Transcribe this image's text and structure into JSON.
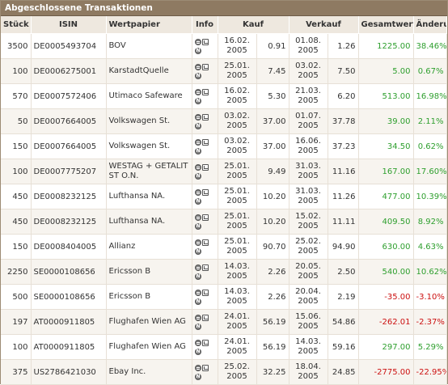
{
  "panel": {
    "title": "Abgeschlossene Transaktionen"
  },
  "columns": {
    "stueck": "Stück",
    "isin": "ISIN",
    "wertpapier": "Wertpapier",
    "info": "Info",
    "kauf": "Kauf",
    "verkauf": "Verkauf",
    "gesamtwert": "Gesamtwert",
    "aenderung": "Änderung"
  },
  "colors": {
    "positive": "#2e9f2e",
    "negative": "#cc1111",
    "header_bar": "#8e7a62"
  },
  "info_icons": [
    "document-icon",
    "chart-icon",
    "news-icon"
  ],
  "rows": [
    {
      "stueck": "3500",
      "isin": "DE0005493704",
      "name": "BOV",
      "kauf_date_1": "16.02.",
      "kauf_date_2": "2005",
      "kauf_price": "0.91",
      "verkauf_date_1": "01.08.",
      "verkauf_date_2": "2005",
      "verkauf_price": "1.26",
      "gesamtwert": "1225.00",
      "aenderung": "38.46%",
      "sign": "pos"
    },
    {
      "stueck": "100",
      "isin": "DE0006275001",
      "name": "KarstadtQuelle",
      "kauf_date_1": "25.01.",
      "kauf_date_2": "2005",
      "kauf_price": "7.45",
      "verkauf_date_1": "03.02.",
      "verkauf_date_2": "2005",
      "verkauf_price": "7.50",
      "gesamtwert": "5.00",
      "aenderung": "0.67%",
      "sign": "pos"
    },
    {
      "stueck": "570",
      "isin": "DE0007572406",
      "name": "Utimaco Safeware",
      "kauf_date_1": "16.02.",
      "kauf_date_2": "2005",
      "kauf_price": "5.30",
      "verkauf_date_1": "21.03.",
      "verkauf_date_2": "2005",
      "verkauf_price": "6.20",
      "gesamtwert": "513.00",
      "aenderung": "16.98%",
      "sign": "pos"
    },
    {
      "stueck": "50",
      "isin": "DE0007664005",
      "name": "Volkswagen St.",
      "kauf_date_1": "03.02.",
      "kauf_date_2": "2005",
      "kauf_price": "37.00",
      "verkauf_date_1": "01.07.",
      "verkauf_date_2": "2005",
      "verkauf_price": "37.78",
      "gesamtwert": "39.00",
      "aenderung": "2.11%",
      "sign": "pos"
    },
    {
      "stueck": "150",
      "isin": "DE0007664005",
      "name": "Volkswagen St.",
      "kauf_date_1": "03.02.",
      "kauf_date_2": "2005",
      "kauf_price": "37.00",
      "verkauf_date_1": "16.06.",
      "verkauf_date_2": "2005",
      "verkauf_price": "37.23",
      "gesamtwert": "34.50",
      "aenderung": "0.62%",
      "sign": "pos"
    },
    {
      "stueck": "100",
      "isin": "DE0007775207",
      "name": "WESTAG + GETALIT ST O.N.",
      "kauf_date_1": "25.01.",
      "kauf_date_2": "2005",
      "kauf_price": "9.49",
      "verkauf_date_1": "31.03.",
      "verkauf_date_2": "2005",
      "verkauf_price": "11.16",
      "gesamtwert": "167.00",
      "aenderung": "17.60%",
      "sign": "pos"
    },
    {
      "stueck": "450",
      "isin": "DE0008232125",
      "name": "Lufthansa NA.",
      "kauf_date_1": "25.01.",
      "kauf_date_2": "2005",
      "kauf_price": "10.20",
      "verkauf_date_1": "31.03.",
      "verkauf_date_2": "2005",
      "verkauf_price": "11.26",
      "gesamtwert": "477.00",
      "aenderung": "10.39%",
      "sign": "pos"
    },
    {
      "stueck": "450",
      "isin": "DE0008232125",
      "name": "Lufthansa NA.",
      "kauf_date_1": "25.01.",
      "kauf_date_2": "2005",
      "kauf_price": "10.20",
      "verkauf_date_1": "15.02.",
      "verkauf_date_2": "2005",
      "verkauf_price": "11.11",
      "gesamtwert": "409.50",
      "aenderung": "8.92%",
      "sign": "pos"
    },
    {
      "stueck": "150",
      "isin": "DE0008404005",
      "name": "Allianz",
      "kauf_date_1": "25.01.",
      "kauf_date_2": "2005",
      "kauf_price": "90.70",
      "verkauf_date_1": "25.02.",
      "verkauf_date_2": "2005",
      "verkauf_price": "94.90",
      "gesamtwert": "630.00",
      "aenderung": "4.63%",
      "sign": "pos"
    },
    {
      "stueck": "2250",
      "isin": "SE0000108656",
      "name": "Ericsson B",
      "kauf_date_1": "14.03.",
      "kauf_date_2": "2005",
      "kauf_price": "2.26",
      "verkauf_date_1": "20.05.",
      "verkauf_date_2": "2005",
      "verkauf_price": "2.50",
      "gesamtwert": "540.00",
      "aenderung": "10.62%",
      "sign": "pos"
    },
    {
      "stueck": "500",
      "isin": "SE0000108656",
      "name": "Ericsson B",
      "kauf_date_1": "14.03.",
      "kauf_date_2": "2005",
      "kauf_price": "2.26",
      "verkauf_date_1": "20.04.",
      "verkauf_date_2": "2005",
      "verkauf_price": "2.19",
      "gesamtwert": "-35.00",
      "aenderung": "-3.10%",
      "sign": "neg"
    },
    {
      "stueck": "197",
      "isin": "AT0000911805",
      "name": "Flughafen Wien AG",
      "kauf_date_1": "24.01.",
      "kauf_date_2": "2005",
      "kauf_price": "56.19",
      "verkauf_date_1": "15.06.",
      "verkauf_date_2": "2005",
      "verkauf_price": "54.86",
      "gesamtwert": "-262.01",
      "aenderung": "-2.37%",
      "sign": "neg"
    },
    {
      "stueck": "100",
      "isin": "AT0000911805",
      "name": "Flughafen Wien AG",
      "kauf_date_1": "24.01.",
      "kauf_date_2": "2005",
      "kauf_price": "56.19",
      "verkauf_date_1": "14.03.",
      "verkauf_date_2": "2005",
      "verkauf_price": "59.16",
      "gesamtwert": "297.00",
      "aenderung": "5.29%",
      "sign": "pos"
    },
    {
      "stueck": "375",
      "isin": "US2786421030",
      "name": "Ebay Inc.",
      "kauf_date_1": "25.02.",
      "kauf_date_2": "2005",
      "kauf_price": "32.25",
      "verkauf_date_1": "18.04.",
      "verkauf_date_2": "2005",
      "verkauf_price": "24.85",
      "gesamtwert": "-2775.00",
      "aenderung": "-22.95%",
      "sign": "neg"
    }
  ]
}
